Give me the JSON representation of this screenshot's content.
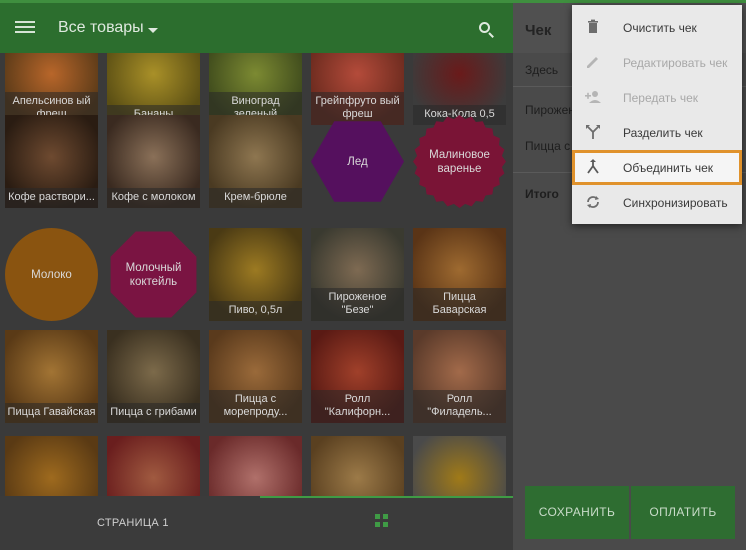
{
  "header": {
    "category_title": "Все товары"
  },
  "products": [
    {
      "label": "Апельсинов ый фреш",
      "colors": [
        "#5a3a18",
        "#b8662a"
      ]
    },
    {
      "label": "Бананы",
      "colors": [
        "#5b4f14",
        "#a99028"
      ]
    },
    {
      "label": "Виноград зеленый",
      "colors": [
        "#3e4a1c",
        "#7c8a32"
      ]
    },
    {
      "label": "Грейпфруто вый фреш",
      "colors": [
        "#6a2a1e",
        "#b44b3a"
      ]
    },
    {
      "label": "Кока-Кола 0,5",
      "colors": [
        "#3c3c3c",
        "#6a1a1a"
      ]
    },
    {
      "label": "Кофе раствори...",
      "colors": [
        "#2a1c12",
        "#6e4a30"
      ]
    },
    {
      "label": "Кофе с молоком",
      "colors": [
        "#3a2a20",
        "#8a7058"
      ]
    },
    {
      "label": "Крем-брюле",
      "colors": [
        "#4a3a22",
        "#8e7650"
      ]
    },
    {
      "label": "Лед",
      "colors": [
        "#55105e"
      ]
    },
    {
      "label": "Малиновое варенье",
      "colors": [
        "#7a1436"
      ]
    },
    {
      "label": "Молоко",
      "colors": [
        "#8a5410"
      ]
    },
    {
      "label": "Молочный коктейль",
      "colors": [
        "#7a1442"
      ]
    },
    {
      "label": "Пиво, 0,5л",
      "colors": [
        "#4a3a14",
        "#9c7a22"
      ]
    },
    {
      "label": "Пироженое \"Безе\"",
      "colors": [
        "#3a3a30",
        "#7e6a52"
      ]
    },
    {
      "label": "Пицца Баварская",
      "colors": [
        "#5a3416",
        "#9e6a30"
      ]
    },
    {
      "label": "Пицца Гавайская",
      "colors": [
        "#5a3a16",
        "#a27434"
      ]
    },
    {
      "label": "Пицца с грибами",
      "colors": [
        "#3a3020",
        "#7c6a4a"
      ]
    },
    {
      "label": "Пицца с морепроду...",
      "colors": [
        "#5a3a1c",
        "#9a6a3a"
      ]
    },
    {
      "label": "Ролл \"Калифорн...",
      "colors": [
        "#5a1a14",
        "#a0402a"
      ]
    },
    {
      "label": "Ролл \"Филадель...",
      "colors": [
        "#5a3a2a",
        "#a26a4a"
      ]
    },
    {
      "label": "",
      "colors": [
        "#5a3a14",
        "#9e6a1e"
      ]
    },
    {
      "label": "",
      "colors": [
        "#6a1e1e",
        "#a05a40"
      ]
    },
    {
      "label": "",
      "colors": [
        "#6a2a2a",
        "#b0706a"
      ]
    },
    {
      "label": "",
      "colors": [
        "#5a4020",
        "#9c7a48"
      ]
    },
    {
      "label": "",
      "colors": [
        "#4a4a4a",
        "#a07a18"
      ]
    }
  ],
  "footer": {
    "page_label": "СТРАНИЦА 1"
  },
  "receipt": {
    "title": "Чек",
    "lines": [
      "Здесь",
      "Пирожен",
      "Пицца с"
    ],
    "total_label": "Итого",
    "save_label": "СОХРАНИТЬ",
    "pay_label": "ОПЛАТИТЬ"
  },
  "menu": {
    "items": [
      {
        "label": "Очистить чек",
        "icon": "trash-icon",
        "enabled": true
      },
      {
        "label": "Редактировать чек",
        "icon": "pencil-icon",
        "enabled": false
      },
      {
        "label": "Передать чек",
        "icon": "person-add-icon",
        "enabled": false
      },
      {
        "label": "Разделить чек",
        "icon": "split-icon",
        "enabled": true
      },
      {
        "label": "Объединить чек",
        "icon": "merge-icon",
        "enabled": true,
        "highlighted": true
      },
      {
        "label": "Синхронизировать",
        "icon": "sync-icon",
        "enabled": true
      }
    ]
  },
  "colors": {
    "brand_green": "#4caf50",
    "highlight_orange": "#f0a030"
  }
}
